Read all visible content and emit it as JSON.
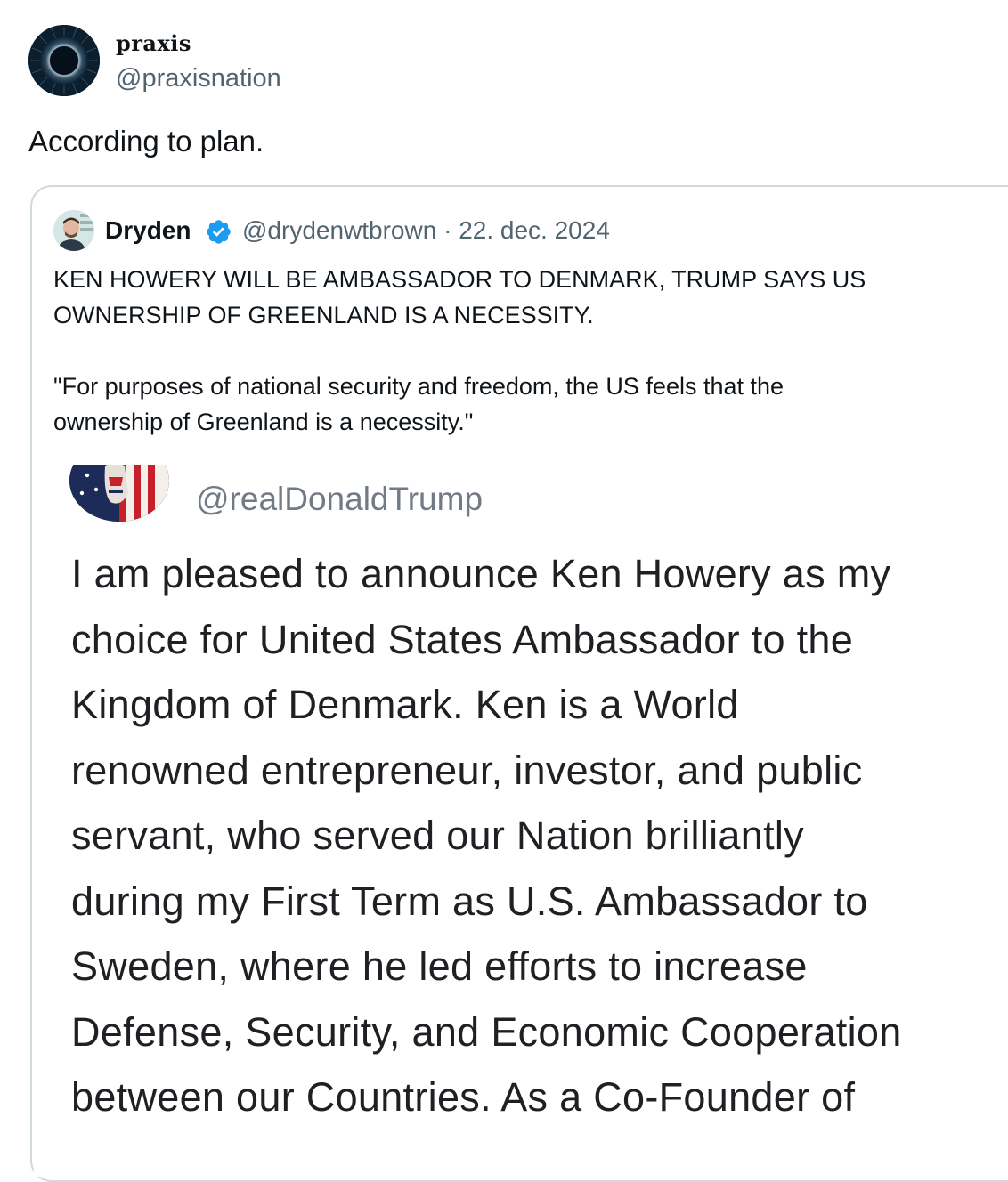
{
  "author": {
    "display_name": "praxis",
    "handle": "@praxisnation",
    "avatar_icon": "dark-circle-logo-icon"
  },
  "post": {
    "text": "According to plan."
  },
  "quote": {
    "author_name": "Dryden",
    "verified": true,
    "verified_icon": "verified-badge-icon",
    "handle": "@drydenwtbrown",
    "separator": "·",
    "date": "22. dec. 2024",
    "text_paragraph_1": "KEN HOWERY WILL BE AMBASSADOR TO DENMARK, TRUMP SAYS US\nOWNERSHIP OF GREENLAND IS A NECESSITY.",
    "text_paragraph_2": "\"For purposes of national security and freedom, the US feels that the\nownership of Greenland is a necessity.\"",
    "embedded_image": {
      "handle": "@realDonaldTrump",
      "avatar_icon": "american-flag-portrait-icon",
      "body_lines": [
        "I am pleased to announce Ken Howery as my",
        "choice for United States Ambassador to the",
        "Kingdom of Denmark. Ken is a World",
        "renowned entrepreneur, investor, and public",
        "servant, who served our Nation brilliantly",
        "during my First Term as U.S. Ambassador to",
        "Sweden, where he led efforts to increase",
        "Defense, Security, and Economic Cooperation",
        "between our Countries. As a Co-Founder of"
      ]
    }
  },
  "colors": {
    "text_primary": "#0f1419",
    "text_secondary": "#536471",
    "border": "#cfd9de",
    "verified_blue": "#1d9bf0"
  }
}
